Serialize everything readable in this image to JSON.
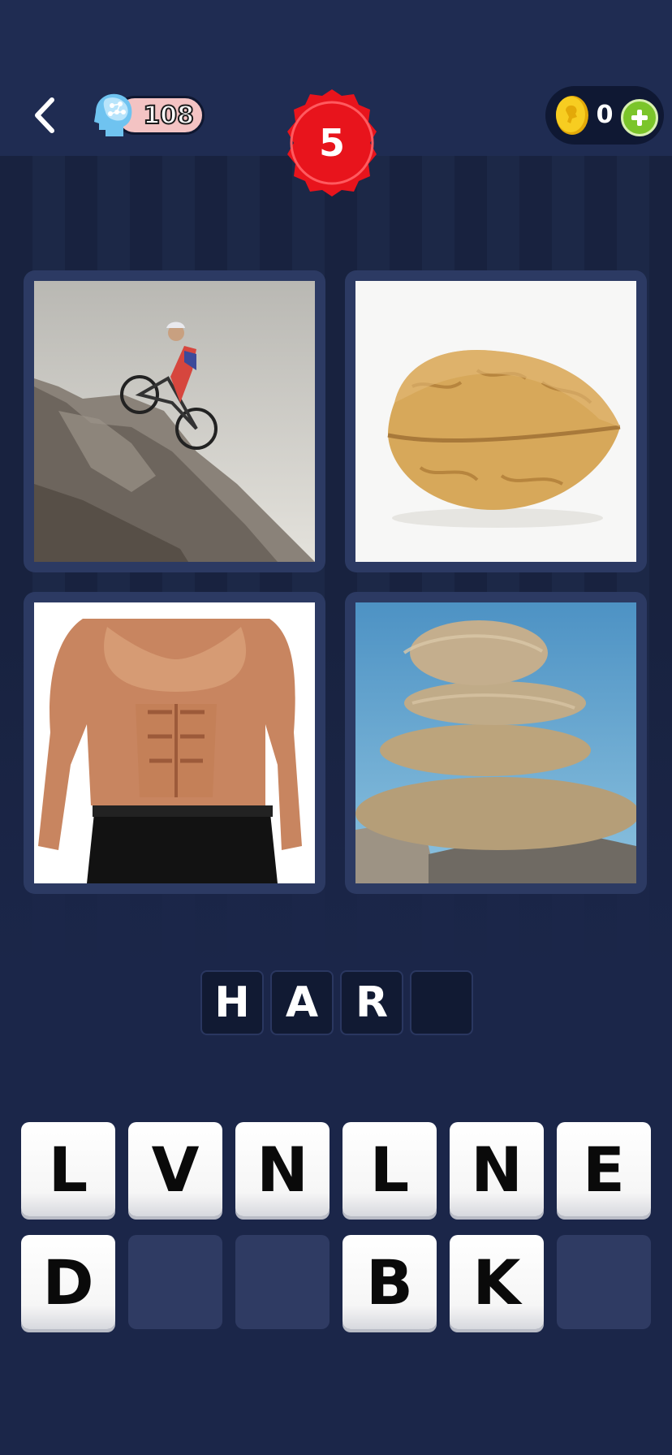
{
  "header": {
    "brain_points": "108",
    "level": "5",
    "coins": "0"
  },
  "icons": {
    "back": "back-chevron-icon",
    "brain": "brain-icon",
    "coin": "coin-icon",
    "plus": "plus-icon"
  },
  "colors": {
    "background": "#1b2649",
    "level_badge": "#e8141c",
    "plus_button": "#7bc52a",
    "coin": "#f3c21b"
  },
  "images": [
    "cyclist riding bike up a rock",
    "walnut",
    "muscular torso with abs",
    "stacked stones by water"
  ],
  "answer": {
    "letters": [
      "H",
      "A",
      "R",
      ""
    ]
  },
  "keyboard": {
    "row1": [
      "L",
      "V",
      "N",
      "L",
      "N",
      "E"
    ],
    "row2": [
      "D",
      "",
      "",
      "B",
      "K",
      ""
    ]
  }
}
